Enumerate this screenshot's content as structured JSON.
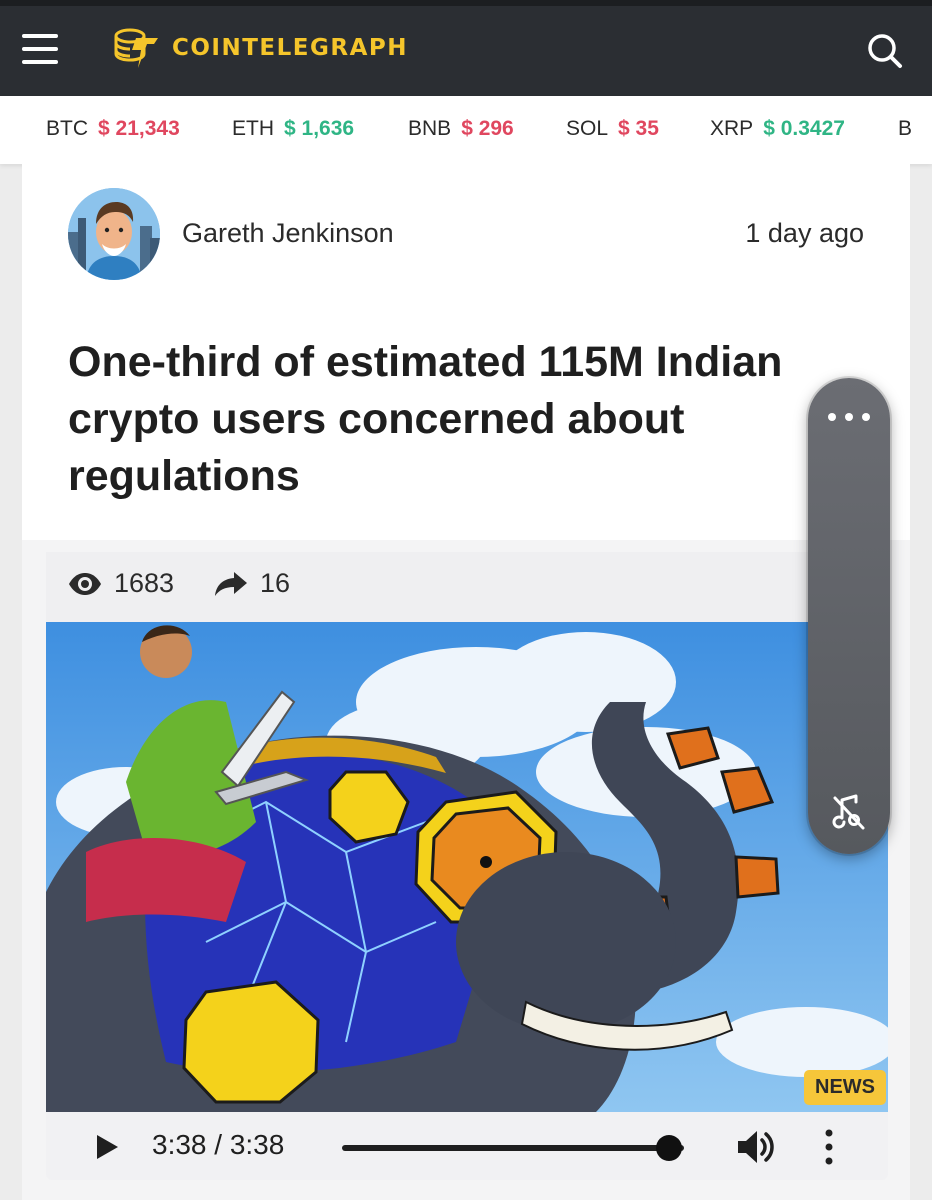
{
  "header": {
    "brand": "COINTELEGRAPH",
    "brand_color": "#f5c52b",
    "menu_icon": "hamburger-menu-icon",
    "search_icon": "search-icon"
  },
  "ticker": [
    {
      "symbol": "BTC",
      "price": "$ 21,343",
      "trend": "down"
    },
    {
      "symbol": "ETH",
      "price": "$ 1,636",
      "trend": "up"
    },
    {
      "symbol": "BNB",
      "price": "$ 296",
      "trend": "down"
    },
    {
      "symbol": "SOL",
      "price": "$ 35",
      "trend": "down"
    },
    {
      "symbol": "XRP",
      "price": "$ 0.3427",
      "trend": "up"
    },
    {
      "symbol": "B",
      "price": "",
      "trend": ""
    }
  ],
  "colors": {
    "down": "#e0475f",
    "up": "#2fb585",
    "badge": "#f6c63a"
  },
  "article": {
    "author": "Gareth Jenkinson",
    "published": "1 day ago",
    "title": "One-third of estimated 115M Indian crypto users concerned about regulations",
    "views": "1683",
    "shares": "16",
    "badge": "NEWS"
  },
  "player": {
    "time": "3:38 / 3:38",
    "progress_fraction": 1.0
  },
  "overlay": {
    "more_icon": "more-horizontal-icon",
    "mute_icon": "music-off-icon"
  }
}
